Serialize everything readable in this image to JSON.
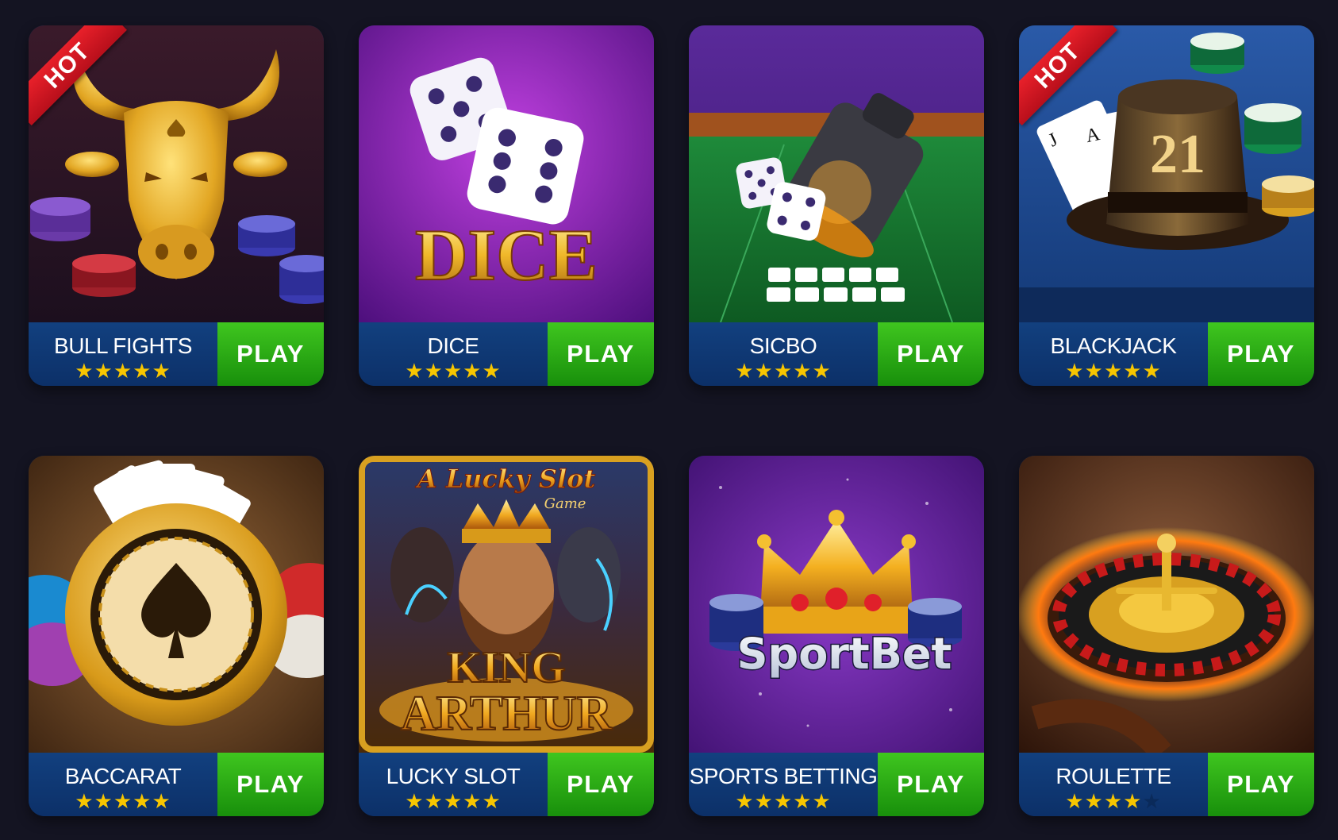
{
  "games": [
    {
      "name": "BULL FIGHTS",
      "play_label": "PLAY",
      "rating": 5,
      "badge": "HOT",
      "icon": "bull-icon"
    },
    {
      "name": "DICE",
      "play_label": "PLAY",
      "rating": 5,
      "badge": "",
      "art_text": "DICE",
      "icon": "dice-icon"
    },
    {
      "name": "SICBO",
      "play_label": "PLAY",
      "rating": 5,
      "badge": "",
      "icon": "dice-cup-icon"
    },
    {
      "name": "BLACKJACK",
      "play_label": "PLAY",
      "rating": 5,
      "badge": "HOT",
      "art_text": "21",
      "icon": "top-hat-icon"
    },
    {
      "name": "BACCARAT",
      "play_label": "PLAY",
      "rating": 5,
      "badge": "",
      "icon": "spade-chip-icon"
    },
    {
      "name": "LUCKY SLOT",
      "play_label": "PLAY",
      "rating": 5,
      "badge": "",
      "art_title": "A Lucky Slot",
      "art_subtitle": "Game",
      "art_line1": "KING",
      "art_line2": "ARTHUR",
      "icon": "king-icon"
    },
    {
      "name": "SPORTS BETTING",
      "play_label": "PLAY",
      "rating": 5,
      "badge": "",
      "art_text": "SportBet",
      "icon": "crown-icon"
    },
    {
      "name": "ROULETTE",
      "play_label": "PLAY",
      "rating": 4,
      "badge": "",
      "icon": "roulette-icon"
    }
  ],
  "colors": {
    "background": "#141422",
    "bar": "#103a78",
    "play": "#2aa814",
    "star": "#f7c600",
    "hot": "#d81a24"
  }
}
